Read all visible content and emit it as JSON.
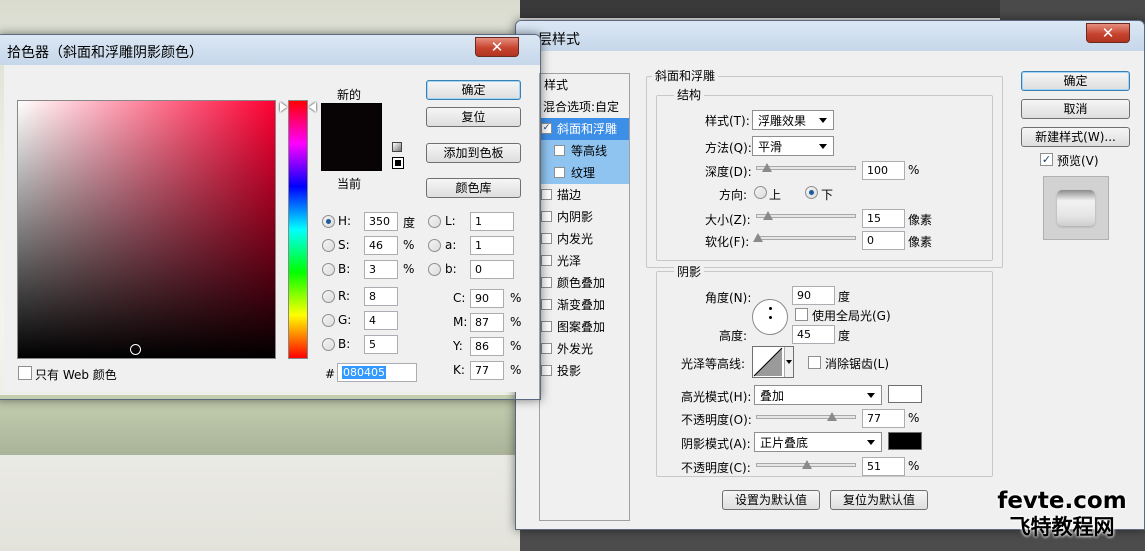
{
  "color_picker": {
    "title": "拾色器（斜面和浮雕阴影颜色）",
    "close": "✕",
    "new_label": "新的",
    "current_label": "当前",
    "new_color": "#080405",
    "current_color": "#080405",
    "buttons": {
      "ok": "确定",
      "reset": "复位",
      "add_swatch": "添加到色板",
      "libraries": "颜色库"
    },
    "fields": {
      "h": {
        "label": "H:",
        "value": "350",
        "unit": "度"
      },
      "s": {
        "label": "S:",
        "value": "46",
        "unit": "%"
      },
      "b": {
        "label": "B:",
        "value": "3",
        "unit": "%"
      },
      "r": {
        "label": "R:",
        "value": "8"
      },
      "g": {
        "label": "G:",
        "value": "4"
      },
      "bb": {
        "label": "B:",
        "value": "5"
      },
      "l": {
        "label": "L:",
        "value": "1"
      },
      "a": {
        "label": "a:",
        "value": "1"
      },
      "lb": {
        "label": "b:",
        "value": "0"
      },
      "c": {
        "label": "C:",
        "value": "90",
        "unit": "%"
      },
      "m": {
        "label": "M:",
        "value": "87",
        "unit": "%"
      },
      "y": {
        "label": "Y:",
        "value": "86",
        "unit": "%"
      },
      "k": {
        "label": "K:",
        "value": "77",
        "unit": "%"
      },
      "hex": {
        "label": "#",
        "value": "080405"
      }
    },
    "web_only": "只有 Web 颜色",
    "hue_color": "#ff0033"
  },
  "layer_style": {
    "title": "图层样式",
    "title_visible": "层样式",
    "close": "✕",
    "styles_header": "样式",
    "blend_options": "混合选项:自定",
    "styles": [
      {
        "label": "斜面和浮雕",
        "checked": true,
        "selected": true,
        "sub": false
      },
      {
        "label": "等高线",
        "checked": false,
        "selected": true,
        "sub": true
      },
      {
        "label": "纹理",
        "checked": false,
        "selected": true,
        "sub": true
      },
      {
        "label": "描边",
        "checked": false,
        "selected": false,
        "sub": false
      },
      {
        "label": "内阴影",
        "checked": false,
        "selected": false,
        "sub": false
      },
      {
        "label": "内发光",
        "checked": false,
        "selected": false,
        "sub": false
      },
      {
        "label": "光泽",
        "checked": false,
        "selected": false,
        "sub": false
      },
      {
        "label": "颜色叠加",
        "checked": false,
        "selected": false,
        "sub": false
      },
      {
        "label": "渐变叠加",
        "checked": false,
        "selected": false,
        "sub": false
      },
      {
        "label": "图案叠加",
        "checked": false,
        "selected": false,
        "sub": false
      },
      {
        "label": "外发光",
        "checked": false,
        "selected": false,
        "sub": false
      },
      {
        "label": "投影",
        "checked": false,
        "selected": false,
        "sub": false
      }
    ],
    "bevel": {
      "section": "斜面和浮雕",
      "structure": "结构",
      "style_label": "样式(T):",
      "style_value": "浮雕效果",
      "technique_label": "方法(Q):",
      "technique_value": "平滑",
      "depth_label": "深度(D):",
      "depth_value": "100",
      "depth_unit": "%",
      "direction_label": "方向:",
      "up": "上",
      "down": "下",
      "size_label": "大小(Z):",
      "size_value": "15",
      "size_unit": "像素",
      "soften_label": "软化(F):",
      "soften_value": "0",
      "soften_unit": "像素"
    },
    "shading": {
      "section": "阴影",
      "angle_label": "角度(N):",
      "angle_value": "90",
      "angle_unit": "度",
      "global_light": "使用全局光(G)",
      "altitude_label": "高度:",
      "altitude_value": "45",
      "altitude_unit": "度",
      "gloss_label": "光泽等高线:",
      "antialias": "消除锯齿(L)",
      "highlight_label": "高光模式(H):",
      "highlight_value": "叠加",
      "highlight_color": "#ffffff",
      "hl_opacity_label": "不透明度(O):",
      "hl_opacity_value": "77",
      "hl_opacity_unit": "%",
      "shadow_label": "阴影模式(A):",
      "shadow_value": "正片叠底",
      "shadow_color": "#000000",
      "sh_opacity_label": "不透明度(C):",
      "sh_opacity_value": "51",
      "sh_opacity_unit": "%"
    },
    "make_default": "设置为默认值",
    "reset_default": "复位为默认值",
    "buttons": {
      "ok": "确定",
      "cancel": "取消",
      "new_style": "新建样式(W)...",
      "preview": "预览(V)"
    }
  },
  "watermark": {
    "line1": "fevte.com",
    "line2": "飞特教程网"
  }
}
